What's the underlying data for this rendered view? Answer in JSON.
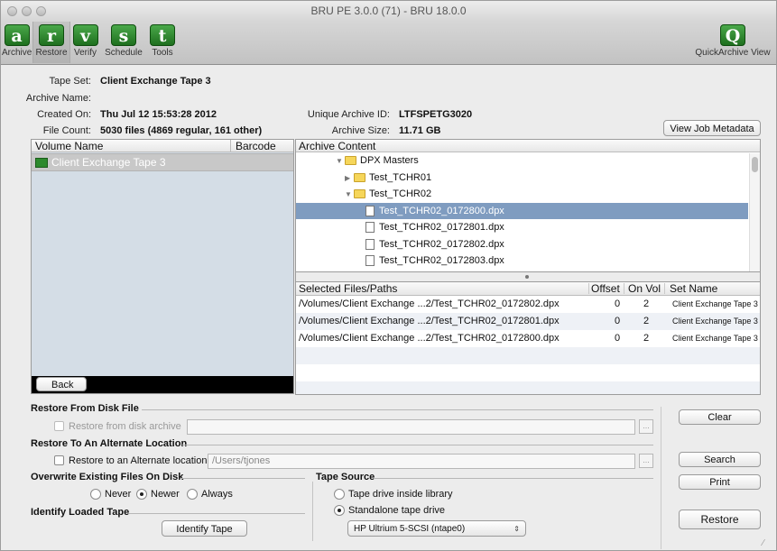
{
  "window": {
    "title": "BRU PE 3.0.0 (71) - BRU 18.0.0"
  },
  "toolbar": {
    "items": [
      {
        "glyph": "a",
        "label": "Archive"
      },
      {
        "glyph": "r",
        "label": "Restore"
      },
      {
        "glyph": "v",
        "label": "Verify"
      },
      {
        "glyph": "s",
        "label": "Schedule"
      },
      {
        "glyph": "t",
        "label": "Tools"
      }
    ],
    "quick": {
      "glyph": "Q",
      "label": "QuickArchive View"
    }
  },
  "info": {
    "tape_set_label": "Tape Set:",
    "tape_set": "Client Exchange Tape 3",
    "archive_name_label": "Archive Name:",
    "archive_name": "",
    "created_on_label": "Created On:",
    "created_on": "Thu Jul 12 15:53:28 2012",
    "file_count_label": "File Count:",
    "file_count": "5030 files (4869 regular, 161 other)",
    "unique_id_label": "Unique Archive ID:",
    "unique_id": "LTFSPETG3020",
    "archive_size_label": "Archive Size:",
    "archive_size": "11.71 GB",
    "view_metadata_button": "View Job Metadata"
  },
  "volumes": {
    "col_name": "Volume Name",
    "col_barcode": "Barcode",
    "items": [
      {
        "name": "Client Exchange Tape 3",
        "barcode": ""
      }
    ],
    "back_button": "Back"
  },
  "archive_content": {
    "header": "Archive Content",
    "tree": [
      {
        "indent": 0,
        "type": "folder",
        "state": "open",
        "name": "DPX Masters"
      },
      {
        "indent": 1,
        "type": "folder",
        "state": "closed",
        "name": "Test_TCHR01"
      },
      {
        "indent": 1,
        "type": "folder",
        "state": "open",
        "name": "Test_TCHR02"
      },
      {
        "indent": 2,
        "type": "file",
        "name": "Test_TCHR02_0172800.dpx",
        "selected": true
      },
      {
        "indent": 2,
        "type": "file",
        "name": "Test_TCHR02_0172801.dpx"
      },
      {
        "indent": 2,
        "type": "file",
        "name": "Test_TCHR02_0172802.dpx"
      },
      {
        "indent": 2,
        "type": "file",
        "name": "Test_TCHR02_0172803.dpx"
      }
    ]
  },
  "selected_files": {
    "columns": [
      "Selected Files/Paths",
      "Offset",
      "On Vol",
      "Set Name"
    ],
    "rows": [
      {
        "path": "/Volumes/Client Exchange ...2/Test_TCHR02_0172802.dpx",
        "offset": "0",
        "on_vol": "2",
        "set_name": "Client Exchange Tape 3"
      },
      {
        "path": "/Volumes/Client Exchange ...2/Test_TCHR02_0172801.dpx",
        "offset": "0",
        "on_vol": "2",
        "set_name": "Client Exchange Tape 3"
      },
      {
        "path": "/Volumes/Client Exchange ...2/Test_TCHR02_0172800.dpx",
        "offset": "0",
        "on_vol": "2",
        "set_name": "Client Exchange Tape 3"
      }
    ]
  },
  "restore": {
    "from_disk_title": "Restore From Disk File",
    "from_disk_checkbox": "Restore from disk archive",
    "from_disk_path": "",
    "alt_location_title": "Restore To An Alternate Location",
    "alt_location_checkbox": "Restore to an Alternate location:",
    "alt_location_path": "/Users/tjones",
    "overwrite_title": "Overwrite Existing Files On Disk",
    "overwrite_options": [
      "Never",
      "Newer",
      "Always"
    ],
    "overwrite_selected": "Newer",
    "identify_title": "Identify Loaded Tape",
    "identify_button": "Identify Tape",
    "tape_source_title": "Tape Source",
    "tape_source_options": [
      "Tape drive inside library",
      "Standalone tape drive"
    ],
    "tape_source_selected": "Standalone tape drive",
    "tape_drive": "HP Ultrium 5-SCSI (ntape0)",
    "ellipsis": "..."
  },
  "actions": {
    "clear": "Clear",
    "search": "Search",
    "print": "Print",
    "restore": "Restore"
  }
}
